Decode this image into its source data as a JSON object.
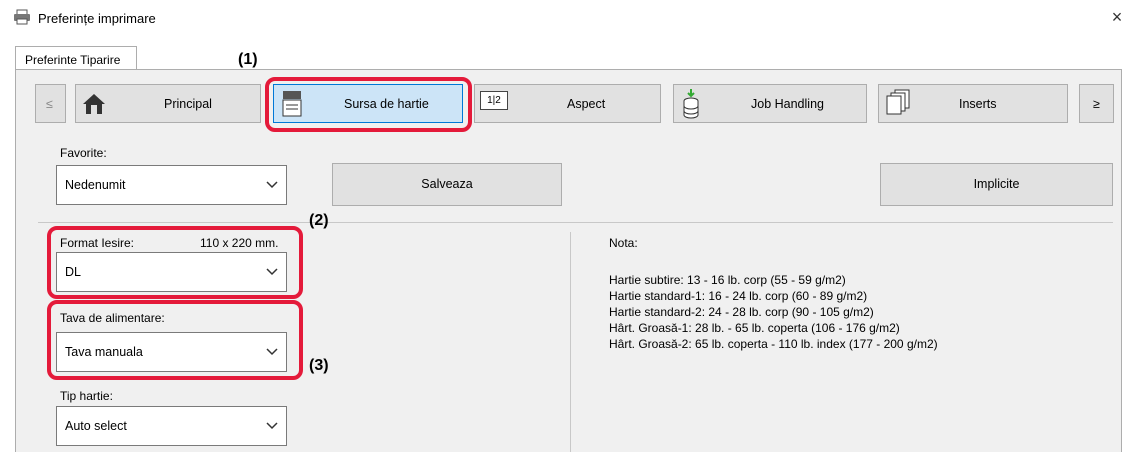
{
  "window": {
    "title": "Preferințe imprimare",
    "close": "×"
  },
  "tabs": [
    {
      "label": "Preferinte Tiparire"
    }
  ],
  "nav": {
    "prev": "≤",
    "next": "≥",
    "buttons": [
      {
        "label": "Principal",
        "icon": "home-icon"
      },
      {
        "label": "Sursa de hartie",
        "icon": "paper-tray-icon"
      },
      {
        "label": "Aspect",
        "icon": "two-pages-icon",
        "icon_text": "1|2"
      },
      {
        "label": "Job Handling",
        "icon": "stack-icon"
      },
      {
        "label": "Inserts",
        "icon": "inserts-icon"
      }
    ]
  },
  "favorites": {
    "label": "Favorite:",
    "value": "Nedenumit",
    "save": "Salveaza",
    "defaults": "Implicite"
  },
  "output_size": {
    "label": "Format Iesire:",
    "dimensions": "110 x 220 mm.",
    "value": "DL"
  },
  "paper_tray": {
    "label": "Tava de alimentare:",
    "value": "Tava manuala"
  },
  "paper_type": {
    "label": "Tip hartie:",
    "value": "Auto select"
  },
  "note": {
    "title": "Nota:",
    "lines": [
      "Hartie subtire: 13 - 16 lb. corp (55 - 59 g/m2)",
      "Hartie standard-1: 16 - 24 lb. corp (60 - 89 g/m2)",
      "Hartie standard-2: 24 - 28 lb. corp (90 - 105 g/m2)",
      "Hârt. Groasă-1: 28 lb. - 65 lb. coperta (106 - 176 g/m2)",
      "Hârt. Groasă-2: 65 lb. coperta - 110 lb. index (177 - 200 g/m2)"
    ]
  },
  "callouts": {
    "c1": "(1)",
    "c2": "(2)",
    "c3": "(3)"
  },
  "colors": {
    "highlight": "#e41a3a",
    "panel": "#f0f0f0",
    "button": "#e1e1e1",
    "selected": "#cce4f7"
  }
}
